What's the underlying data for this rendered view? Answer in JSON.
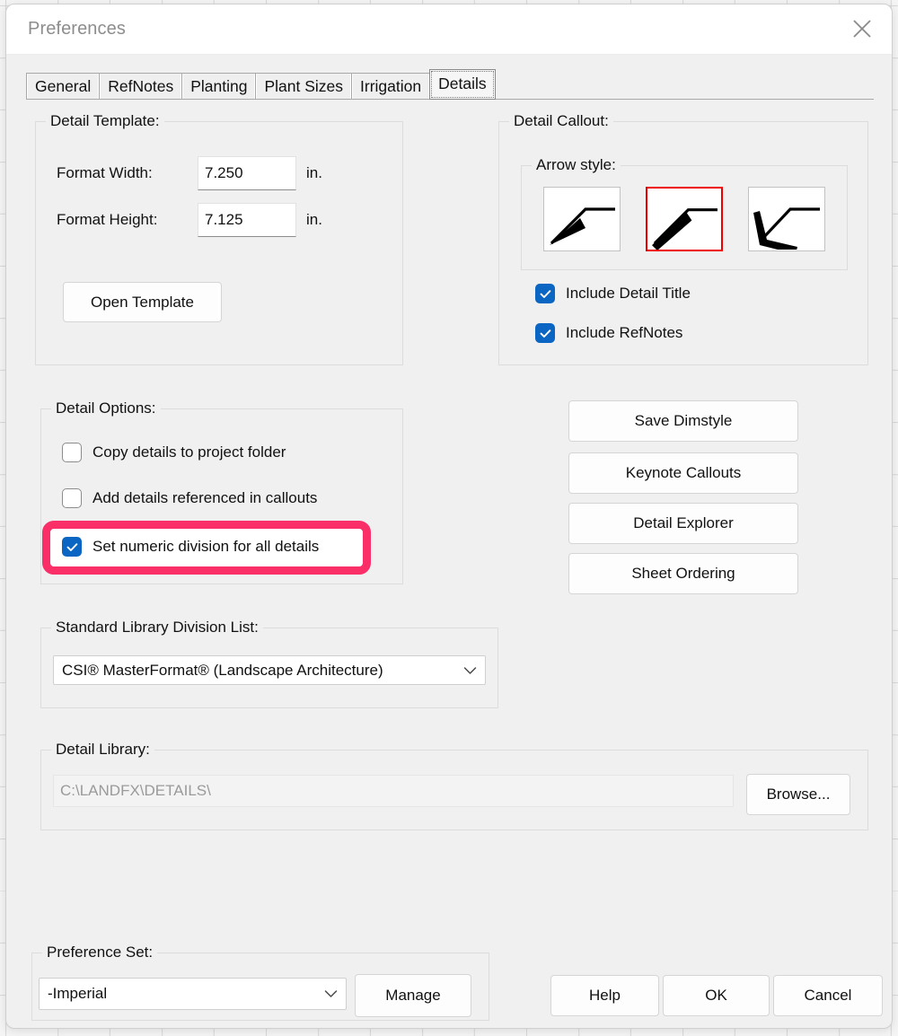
{
  "window": {
    "title": "Preferences",
    "close_icon": "close-x-icon"
  },
  "tabs": [
    {
      "label": "General",
      "selected": false
    },
    {
      "label": "RefNotes",
      "selected": false
    },
    {
      "label": "Planting",
      "selected": false
    },
    {
      "label": "Plant Sizes",
      "selected": false
    },
    {
      "label": "Irrigation",
      "selected": false
    },
    {
      "label": "Details",
      "selected": true
    }
  ],
  "detail_template": {
    "group_title": "Detail Template:",
    "format_width_label": "Format Width:",
    "format_width_value": "7.250",
    "format_width_units": "in.",
    "format_height_label": "Format Height:",
    "format_height_value": "7.125",
    "format_height_units": "in.",
    "open_template_button": "Open Template"
  },
  "detail_callout": {
    "group_title": "Detail Callout:",
    "arrow_style_label": "Arrow style:",
    "arrow_styles": [
      {
        "name": "filled-triangle-arrowhead",
        "selected": false
      },
      {
        "name": "thick-tapered-bar-arrowhead",
        "selected": true
      },
      {
        "name": "open-tick-arrowhead",
        "selected": false
      }
    ],
    "include_detail_title_label": "Include Detail Title",
    "include_detail_title_checked": true,
    "include_refnotes_label": "Include RefNotes",
    "include_refnotes_checked": true
  },
  "detail_options": {
    "group_title": "Detail Options:",
    "items": [
      {
        "label": "Copy details to project folder",
        "checked": false,
        "highlighted": false
      },
      {
        "label": "Add details referenced in callouts",
        "checked": false,
        "highlighted": false
      },
      {
        "label": "Set numeric division for all details",
        "checked": true,
        "highlighted": true
      }
    ]
  },
  "action_buttons": [
    {
      "label": "Save Dimstyle"
    },
    {
      "label": "Keynote Callouts"
    },
    {
      "label": "Detail Explorer"
    },
    {
      "label": "Sheet Ordering"
    }
  ],
  "standard_library": {
    "group_title": "Standard Library Division List:",
    "selected_value": "CSI® MasterFormat® (Landscape Architecture)"
  },
  "detail_library": {
    "group_title": "Detail Library:",
    "path_value": "C:\\LANDFX\\DETAILS\\",
    "browse_button": "Browse..."
  },
  "preference_set": {
    "group_title": "Preference Set:",
    "selected_value": "-Imperial",
    "manage_button": "Manage"
  },
  "footer_buttons": [
    {
      "label": "Help"
    },
    {
      "label": "OK"
    },
    {
      "label": "Cancel"
    }
  ],
  "colors": {
    "accent_checkbox": "#0b66c3",
    "annotation_highlight": "#fb2f68",
    "selected_arrow_border": "#ee0000"
  }
}
